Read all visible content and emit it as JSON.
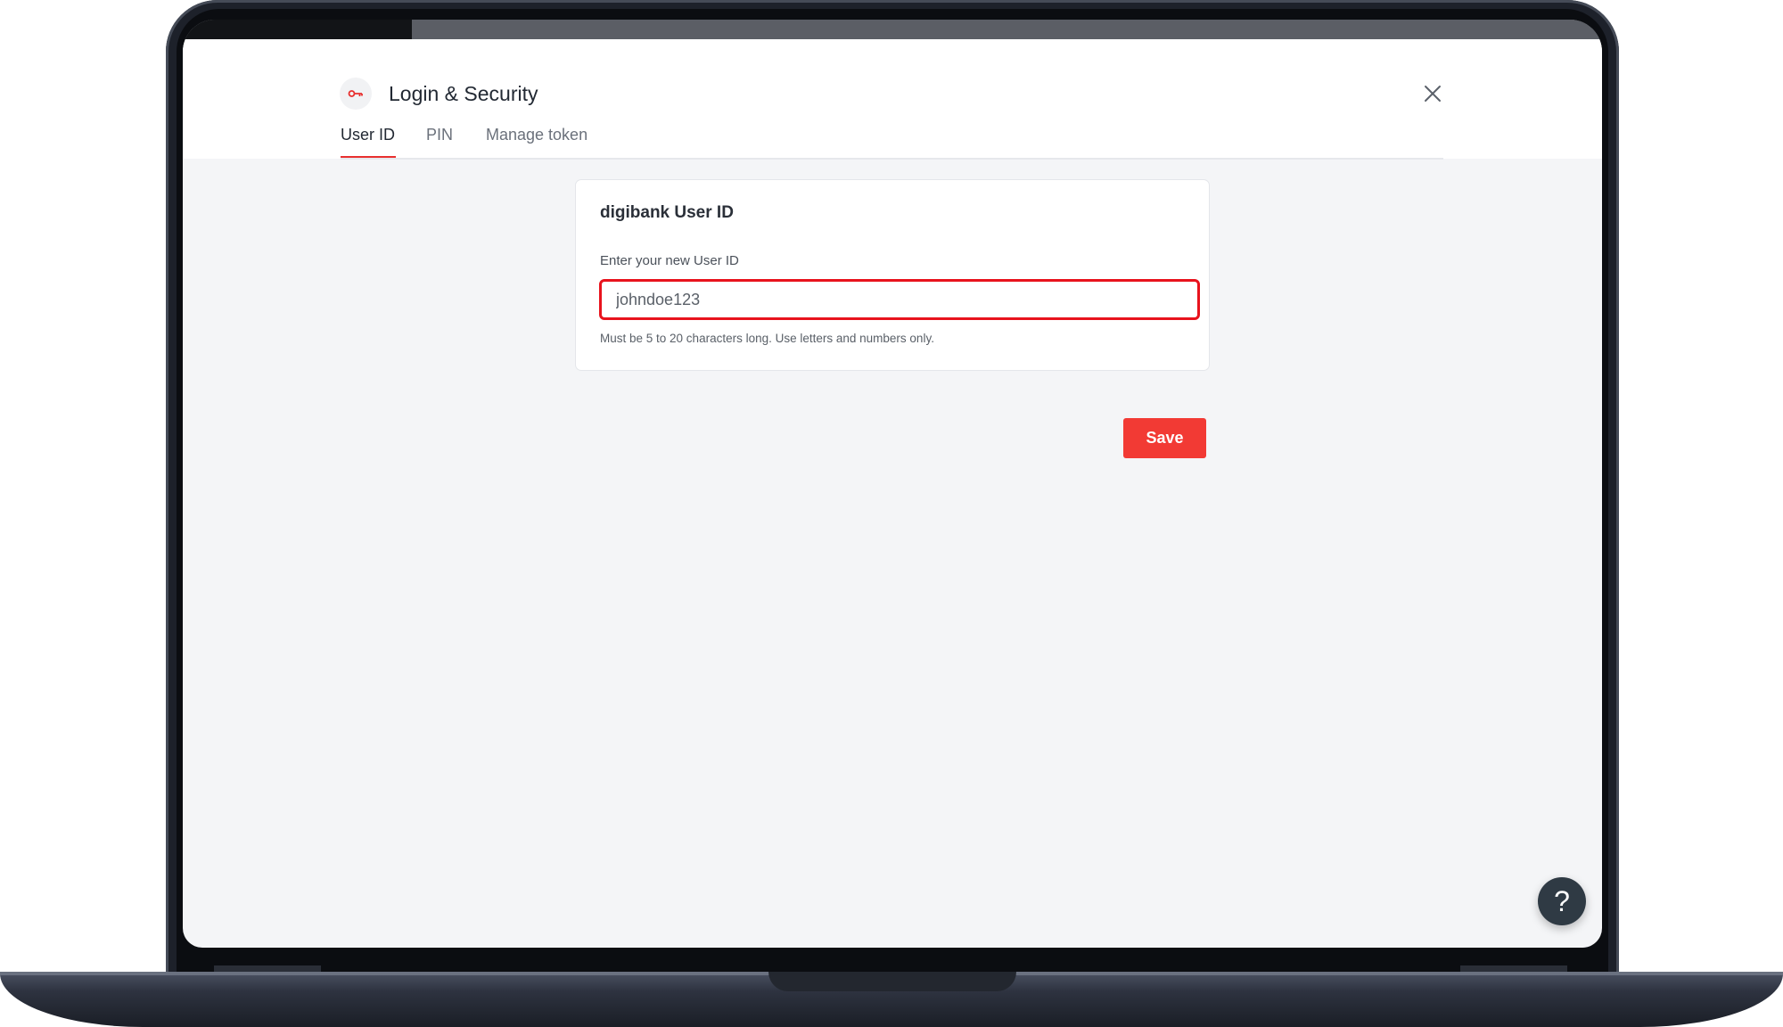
{
  "dialog": {
    "title": "Login & Security",
    "icon": "key-icon",
    "close_icon": "close-icon"
  },
  "tabs": [
    {
      "label": "User ID",
      "active": true
    },
    {
      "label": "PIN",
      "active": false
    },
    {
      "label": "Manage token",
      "active": false
    }
  ],
  "card": {
    "title": "digibank User ID",
    "field_label": "Enter your new User ID",
    "input_value": "johndoe123",
    "helper_text": "Must be 5 to 20 characters long. Use letters and numbers only."
  },
  "actions": {
    "save_label": "Save"
  },
  "help": {
    "label": "?"
  },
  "colors": {
    "accent": "#e8302f",
    "error_border": "#e8131d",
    "save_button": "#f23a34",
    "help_button": "#2f3a44"
  }
}
